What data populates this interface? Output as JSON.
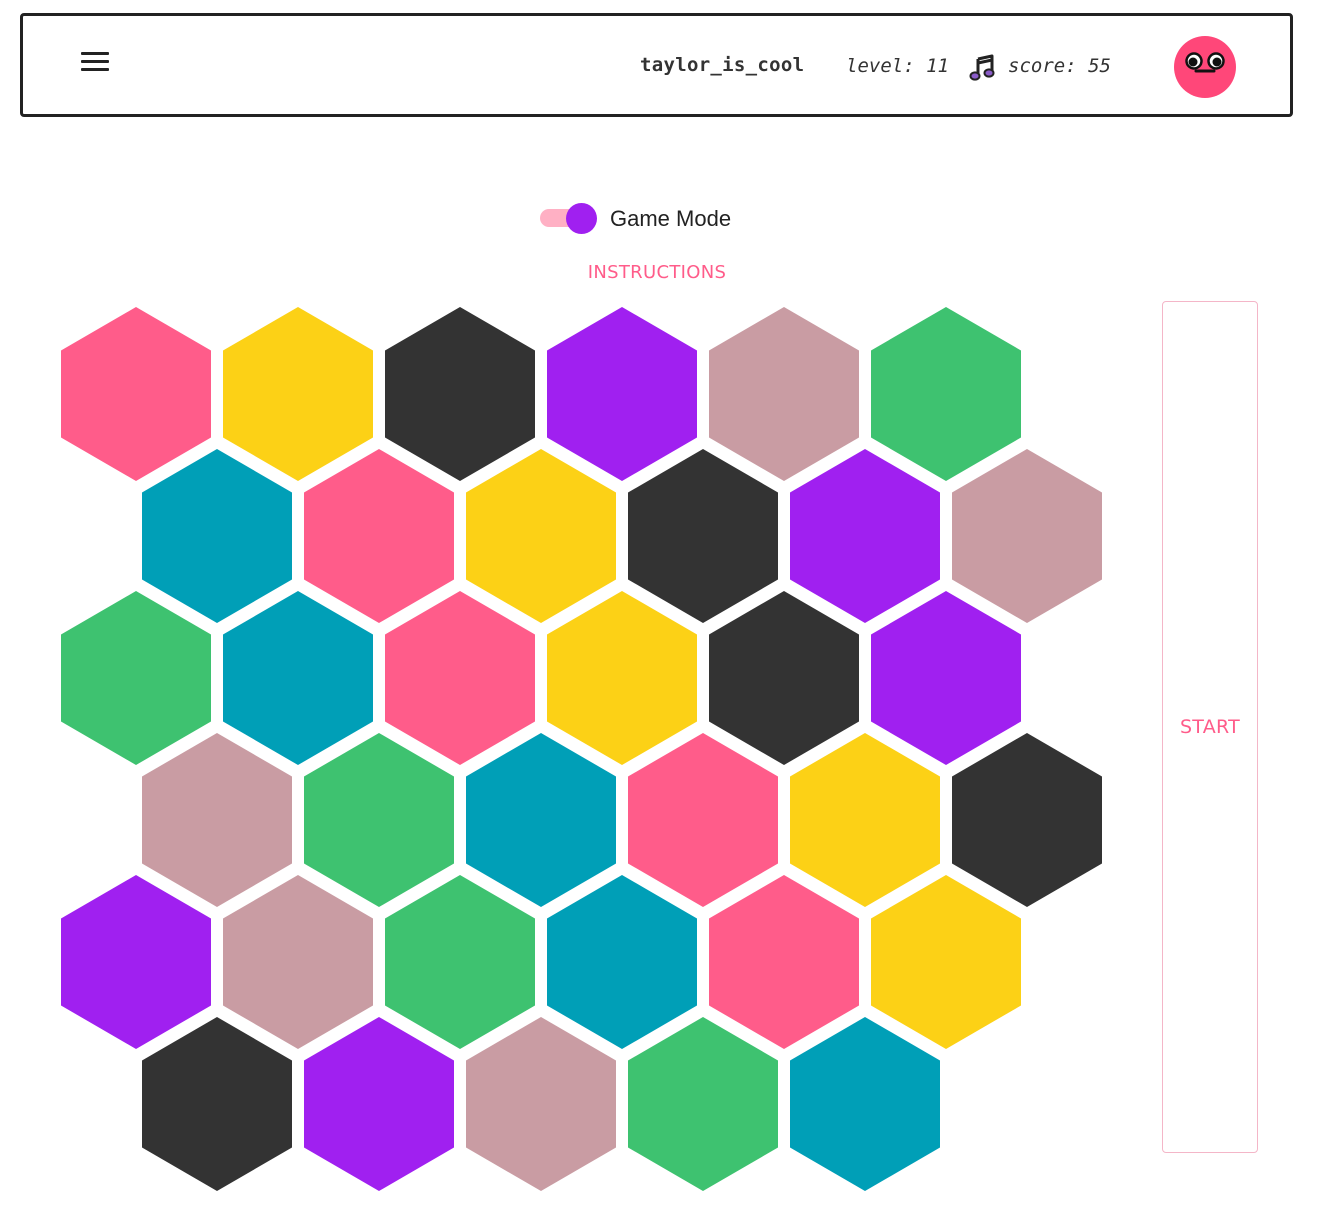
{
  "header": {
    "username": "taylor_is_cool",
    "level_text": "level: 11",
    "score_text": "score: 55",
    "menu_icon": "hamburger-menu-icon",
    "music_icon": "music-note-icon",
    "avatar_icon": "pink-face-avatar-icon"
  },
  "mode_toggle": {
    "label": "Game Mode",
    "on": true
  },
  "instructions_label": "INSTRUCTIONS",
  "start_label": "START",
  "colors": {
    "pink": "#ff5c8a",
    "yellow": "#fcd116",
    "black": "#333333",
    "purple": "#a020f0",
    "mauve": "#c99ca3",
    "green": "#3ec270",
    "teal": "#009fb7",
    "toggle_track": "#ffb0c4",
    "accent_text": "#ff5c8a"
  },
  "board": {
    "rows": [
      [
        "pink",
        "yellow",
        "black",
        "purple",
        "mauve",
        "green"
      ],
      [
        "teal",
        "pink",
        "yellow",
        "black",
        "purple",
        "mauve"
      ],
      [
        "green",
        "teal",
        "pink",
        "yellow",
        "black",
        "purple"
      ],
      [
        "mauve",
        "green",
        "teal",
        "pink",
        "yellow",
        "black"
      ],
      [
        "purple",
        "mauve",
        "green",
        "teal",
        "pink",
        "yellow"
      ],
      [
        "black",
        "purple",
        "mauve",
        "green",
        "teal"
      ]
    ]
  }
}
